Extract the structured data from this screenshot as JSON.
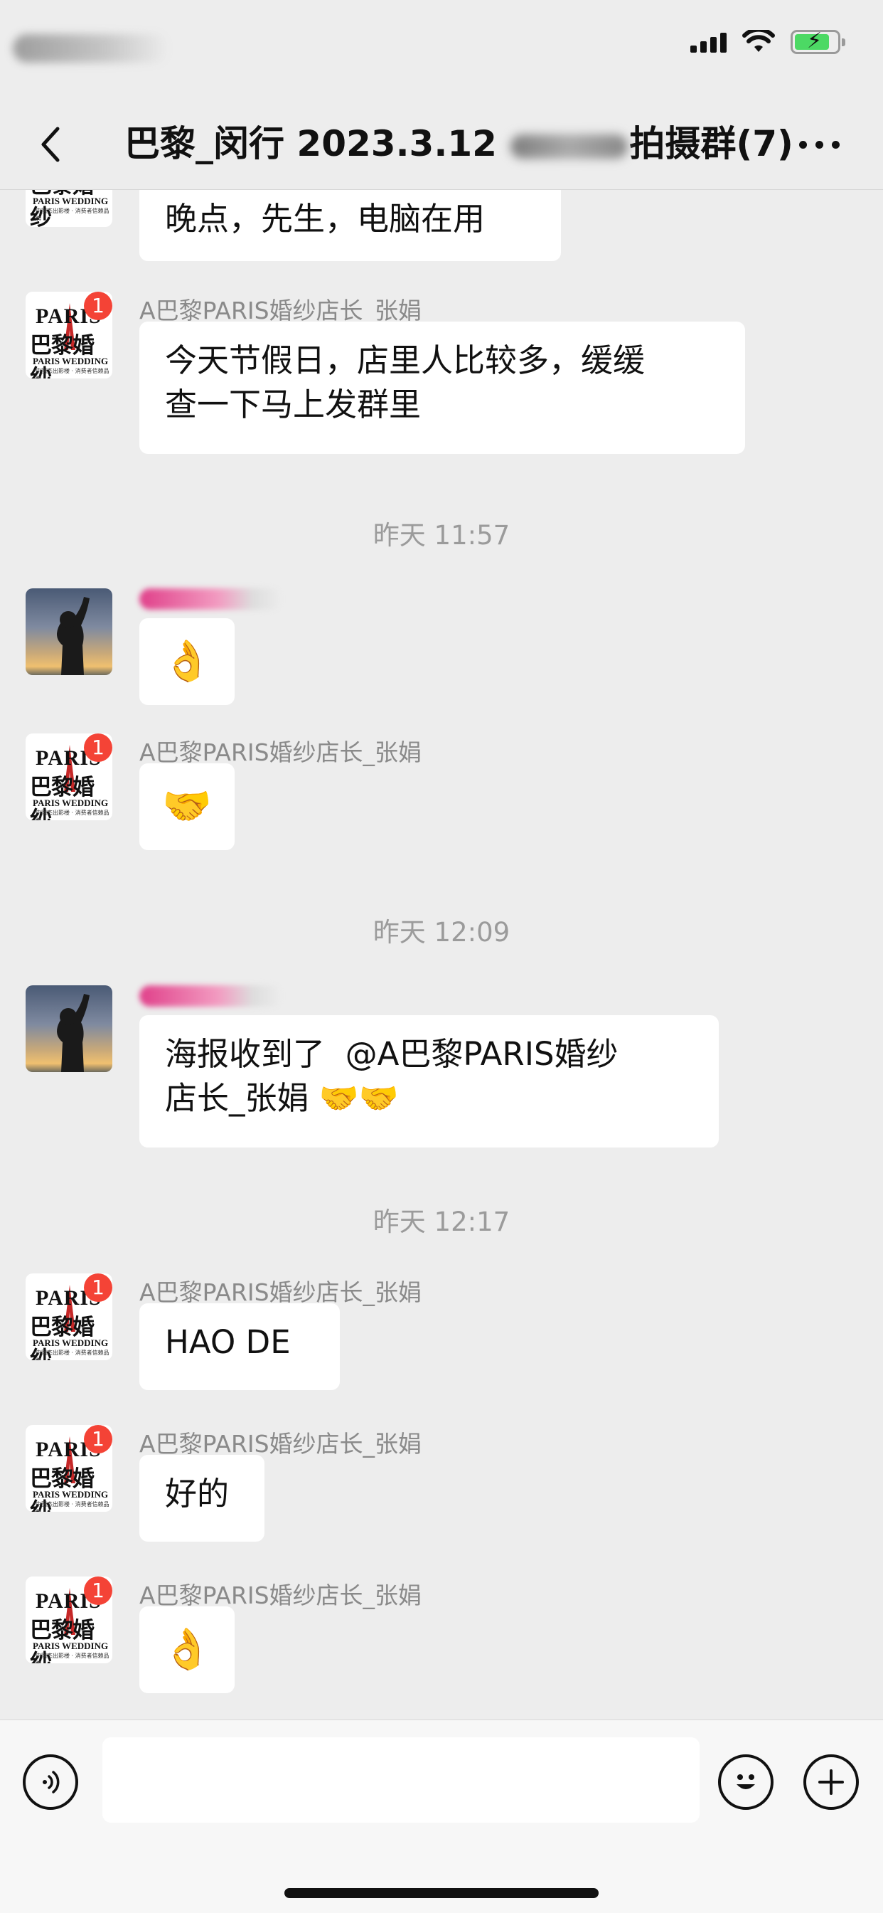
{
  "status_bar": {
    "icons": [
      "signal-icon",
      "wifi-icon",
      "battery-charging-icon"
    ]
  },
  "nav": {
    "title_prefix": "巴黎_闵行 2023.3.12",
    "title_suffix": "拍摄群",
    "member_count": "(7)",
    "back_icon": "chevron-left-icon",
    "more_icon": "more-icon"
  },
  "messages": [
    {
      "type": "text",
      "sender": "",
      "avatar": "paris",
      "text": "晚点，先生，电脑在用"
    },
    {
      "type": "text",
      "sender": "A巴黎PARIS婚纱店长_张娟",
      "avatar": "paris",
      "text": "今天节假日，店里人比较多，缓缓\n查一下马上发群里"
    },
    {
      "type": "time",
      "text": "昨天 11:57"
    },
    {
      "type": "emoji",
      "sender": "",
      "avatar": "person",
      "text": "👌"
    },
    {
      "type": "emoji",
      "sender": "A巴黎PARIS婚纱店长_张娟",
      "avatar": "paris",
      "text": "🤝"
    },
    {
      "type": "time",
      "text": "昨天 12:09"
    },
    {
      "type": "text",
      "sender": "",
      "avatar": "person",
      "text": "海报收到了  @A巴黎PARIS婚纱\n店长_张娟 🤝🤝"
    },
    {
      "type": "time",
      "text": "昨天 12:17"
    },
    {
      "type": "text",
      "sender": "A巴黎PARIS婚纱店长_张娟",
      "avatar": "paris",
      "text": "HAO DE"
    },
    {
      "type": "text",
      "sender": "A巴黎PARIS婚纱店长_张娟",
      "avatar": "paris",
      "text": "好的"
    },
    {
      "type": "emoji",
      "sender": "A巴黎PARIS婚纱店长_张娟",
      "avatar": "paris",
      "text": "👌"
    }
  ],
  "avatar_paris": {
    "brand": "PARIS",
    "name_cn": "巴黎婚纱",
    "name_en": "PARIS WEDDING",
    "tagline": "中国杰出影楼 · 消费者信赖品牌",
    "badge": "1"
  },
  "input_bar": {
    "voice_icon": "voice-icon",
    "emoji_icon": "smiley-icon",
    "plus_icon": "plus-icon",
    "placeholder": ""
  },
  "colors": {
    "background": "#ededed",
    "bubble": "#ffffff",
    "badge": "#f44336",
    "battery": "#4cd964"
  }
}
